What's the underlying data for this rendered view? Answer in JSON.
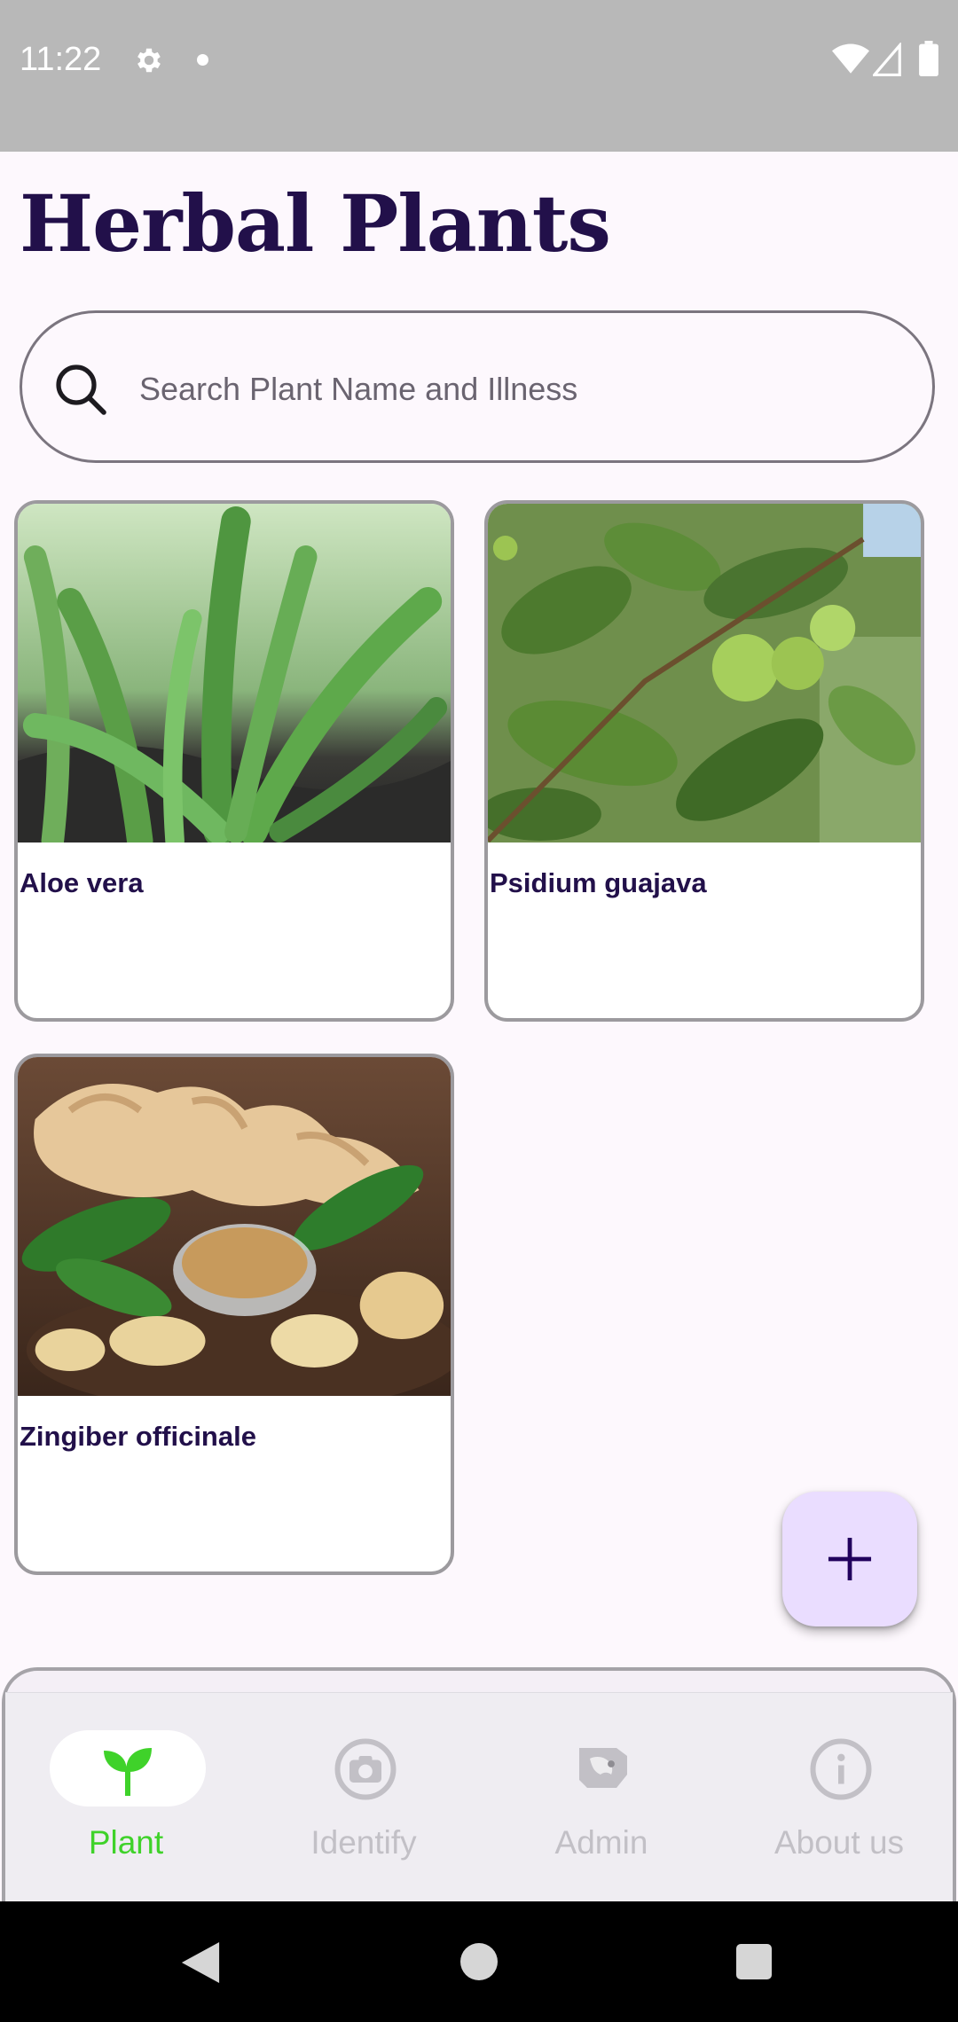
{
  "status_bar": {
    "time": "11:22"
  },
  "page": {
    "title": "Herbal Plants"
  },
  "search": {
    "placeholder": "Search Plant Name and Illness",
    "value": ""
  },
  "plants": [
    {
      "name": "Aloe vera"
    },
    {
      "name": "Psidium guajava"
    },
    {
      "name": "Zingiber officinale"
    }
  ],
  "fab": {
    "icon": "plus-icon"
  },
  "bottom_nav": {
    "items": [
      {
        "label": "Plant",
        "icon": "sprout-icon",
        "active": true
      },
      {
        "label": "Identify",
        "icon": "camera-icon",
        "active": false
      },
      {
        "label": "Admin",
        "icon": "admin-icon",
        "active": false
      },
      {
        "label": "About us",
        "icon": "info-icon",
        "active": false
      }
    ]
  },
  "colors": {
    "title": "#22104a",
    "active_nav": "#3fd22a",
    "inactive_nav": "#c2c0c6",
    "fab_bg": "#eaddff",
    "status_bar_bg": "#b8b8b8"
  }
}
